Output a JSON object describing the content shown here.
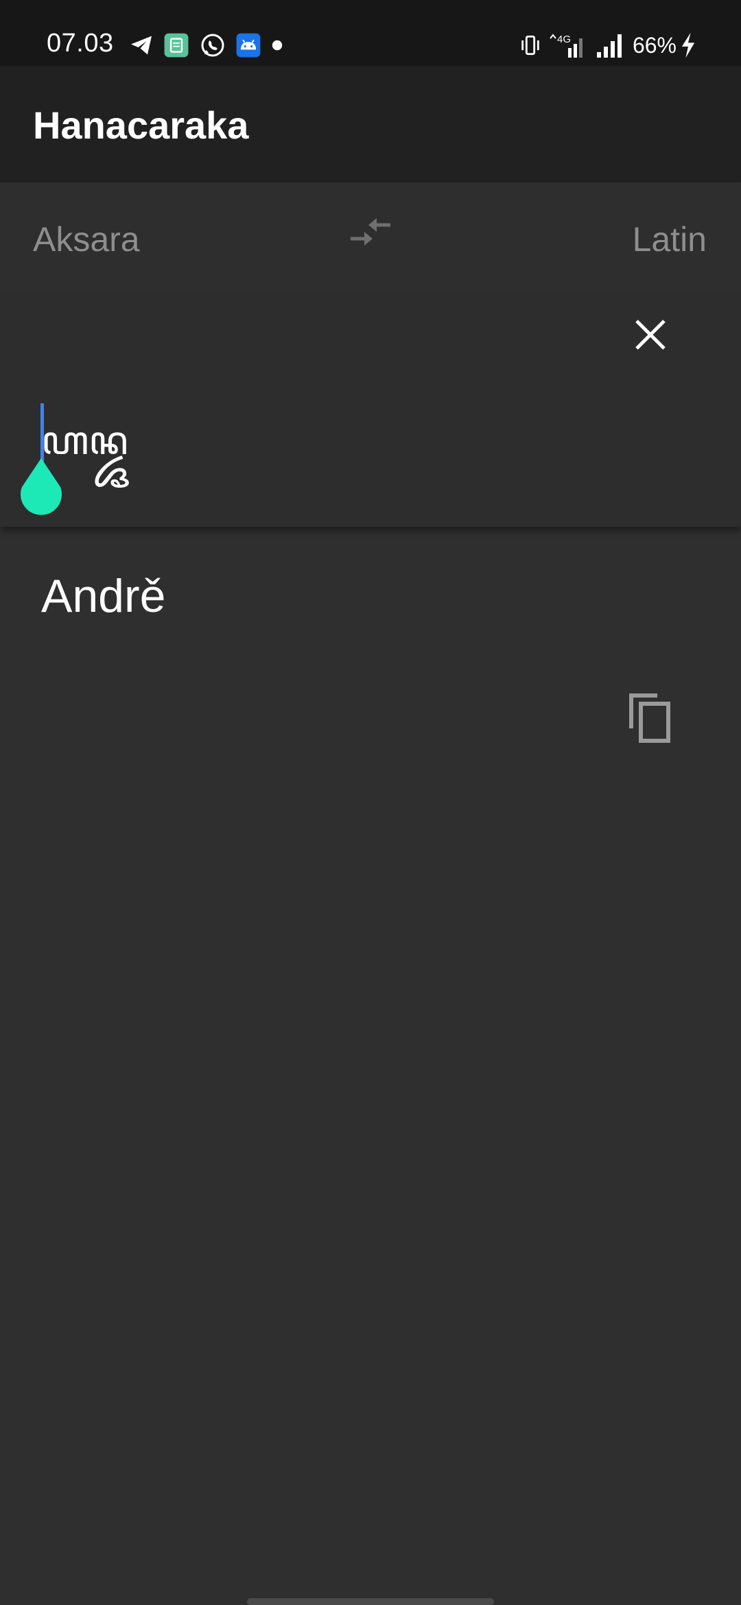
{
  "status_bar": {
    "time": "07.03",
    "notification_icons": [
      "telegram-icon",
      "calculator-app-icon",
      "whatsapp-icon",
      "android-app-icon",
      "dot-icon"
    ],
    "network_label": "4G",
    "battery_percent": "66%",
    "charging": true
  },
  "app_bar": {
    "title": "Hanacaraka"
  },
  "language_row": {
    "source_language": "Aksara",
    "target_language": "Latin",
    "swap_icon": "swap-arrows-icon"
  },
  "input": {
    "value": "ꦲꦤ꧀ꦢꦽ",
    "clear_icon": "close-icon"
  },
  "output": {
    "value": "Andrě",
    "copy_icon": "copy-icon"
  },
  "colors": {
    "status_bar_bg": "#171717",
    "app_bar_bg": "#212121",
    "background": "#2f2f2f",
    "cursor": "#3b82f6",
    "cursor_handle": "#1de9b6",
    "muted_text": "#8e8e8e"
  }
}
